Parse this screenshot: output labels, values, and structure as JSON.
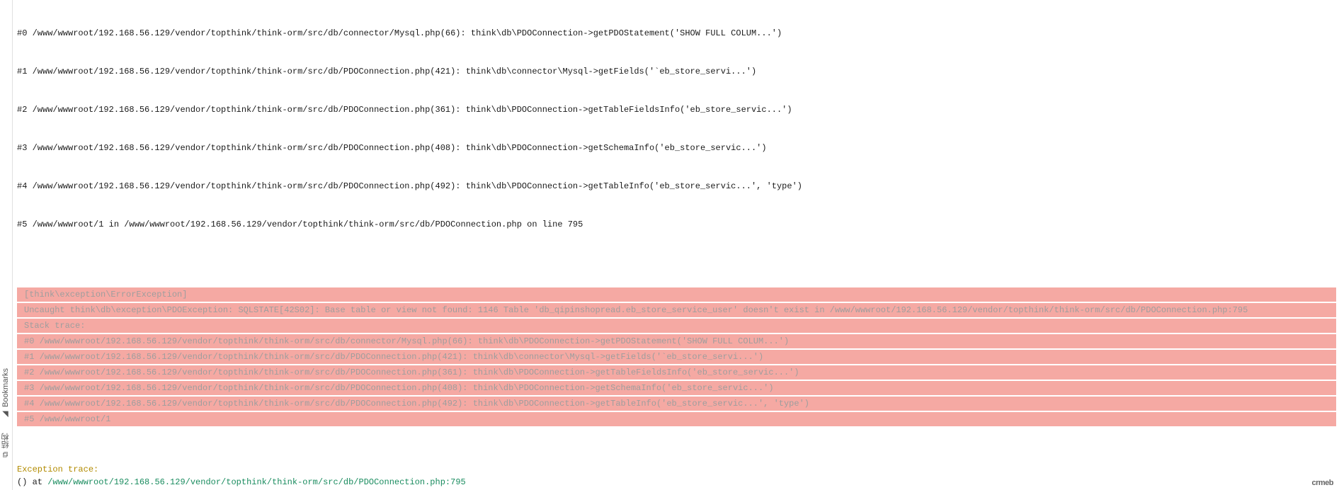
{
  "left_tabs": {
    "bookmarks": "Bookmarks",
    "structure": "结构"
  },
  "stack_top": [
    "#0 /www/wwwroot/192.168.56.129/vendor/topthink/think-orm/src/db/connector/Mysql.php(66): think\\db\\PDOConnection->getPDOStatement('SHOW FULL COLUM...')",
    "#1 /www/wwwroot/192.168.56.129/vendor/topthink/think-orm/src/db/PDOConnection.php(421): think\\db\\connector\\Mysql->getFields('`eb_store_servi...')",
    "#2 /www/wwwroot/192.168.56.129/vendor/topthink/think-orm/src/db/PDOConnection.php(361): think\\db\\PDOConnection->getTableFieldsInfo('eb_store_servic...')",
    "#3 /www/wwwroot/192.168.56.129/vendor/topthink/think-orm/src/db/PDOConnection.php(408): think\\db\\PDOConnection->getSchemaInfo('eb_store_servic...')",
    "#4 /www/wwwroot/192.168.56.129/vendor/topthink/think-orm/src/db/PDOConnection.php(492): think\\db\\PDOConnection->getTableInfo('eb_store_servic...', 'type')",
    "#5 /www/wwwroot/1 in /www/wwwroot/192.168.56.129/vendor/topthink/think-orm/src/db/PDOConnection.php on line 795"
  ],
  "hl_block": [
    "[think\\exception\\ErrorException]",
    "Uncaught think\\db\\exception\\PDOException: SQLSTATE[42S02]: Base table or view not found: 1146 Table 'db_qipinshopread.eb_store_service_user' doesn't exist in /www/wwwroot/192.168.56.129/vendor/topthink/think-orm/src/db/PDOConnection.php:795",
    "Stack trace:",
    "#0 /www/wwwroot/192.168.56.129/vendor/topthink/think-orm/src/db/connector/Mysql.php(66): think\\db\\PDOConnection->getPDOStatement('SHOW FULL COLUM...')",
    "#1 /www/wwwroot/192.168.56.129/vendor/topthink/think-orm/src/db/PDOConnection.php(421): think\\db\\connector\\Mysql->getFields('`eb_store_servi...')",
    "#2 /www/wwwroot/192.168.56.129/vendor/topthink/think-orm/src/db/PDOConnection.php(361): think\\db\\PDOConnection->getTableFieldsInfo('eb_store_servic...')",
    "#3 /www/wwwroot/192.168.56.129/vendor/topthink/think-orm/src/db/PDOConnection.php(408): think\\db\\PDOConnection->getSchemaInfo('eb_store_servic...')",
    "#4 /www/wwwroot/192.168.56.129/vendor/topthink/think-orm/src/db/PDOConnection.php(492): think\\db\\PDOConnection->getTableInfo('eb_store_servic...', 'type')",
    "#5 /www/wwwroot/1"
  ],
  "exc": {
    "title": "Exception trace:",
    "prefix": " () at ",
    "path": "/www/wwwroot/192.168.56.129/vendor/topthink/think-orm/src/db/PDOConnection.php:795"
  },
  "brand": "crmeb"
}
